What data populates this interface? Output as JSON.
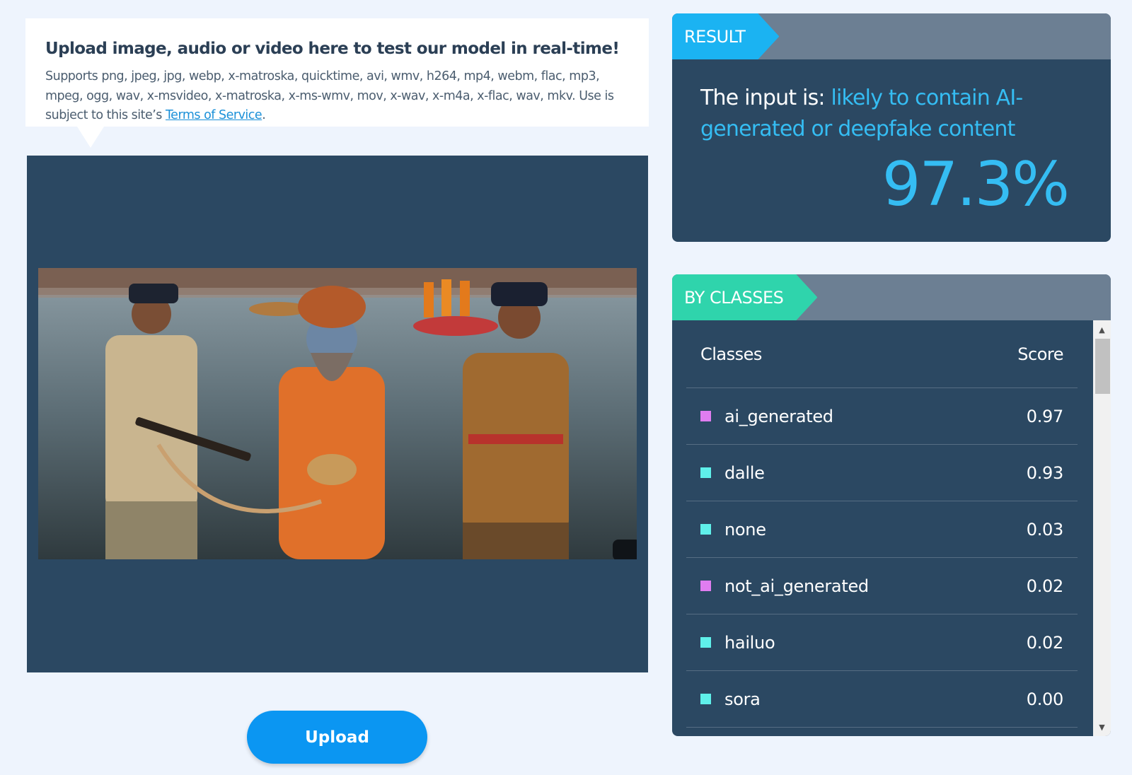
{
  "info": {
    "title": "Upload image, audio or video here to test our model in real-time!",
    "description_prefix": "Supports png, jpeg, jpg, webp, x-matroska, quicktime, avi, wmv, h264, mp4, webm, flac, mp3, mpeg, ogg, wav, x-msvideo, x-matroska, x-ms-wmv, mov, x-wav, x-m4a, x-flac, wav, mkv. Use is subject to this site’s ",
    "terms_link": "Terms of Service",
    "description_suffix": "."
  },
  "media": {
    "image_description": "Uploaded photo preview"
  },
  "upload": {
    "label": "Upload"
  },
  "result": {
    "tag": "RESULT",
    "prefix": "The input is: ",
    "verdict": "likely to contain AI-generated or deepfake content",
    "score": "97.3%"
  },
  "classes": {
    "tag": "BY CLASSES",
    "header_class": "Classes",
    "header_score": "Score",
    "rows": [
      {
        "name": "ai_generated",
        "score": "0.97",
        "color": "#e07df0"
      },
      {
        "name": "dalle",
        "score": "0.93",
        "color": "#5ff0ea"
      },
      {
        "name": "none",
        "score": "0.03",
        "color": "#5ff0ea"
      },
      {
        "name": "not_ai_generated",
        "score": "0.02",
        "color": "#e07df0"
      },
      {
        "name": "hailuo",
        "score": "0.02",
        "color": "#5ff0ea"
      },
      {
        "name": "sora",
        "score": "0.00",
        "color": "#5ff0ea"
      }
    ]
  },
  "colors": {
    "accent_blue": "#35bdf3",
    "tag_result": "#1bb3f2",
    "tag_classes": "#2fd4ac",
    "panel": "#2b4862",
    "upload_button": "#0b96f2"
  }
}
